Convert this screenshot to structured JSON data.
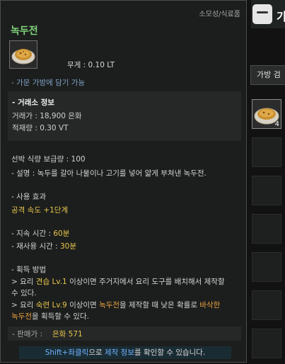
{
  "tooltip": {
    "category": "소모성/식료품",
    "title": "녹두전",
    "weight": "무게 :  0.10 LT",
    "bag_note": "- 가문 가방에 담기 가능",
    "market": {
      "header": "- 거래소 정보",
      "price": "거래가 : 18,900 은화",
      "load": "적재량 : 0.30 VT"
    },
    "ship_food": "선박 식량 보급량 : 100",
    "description": "- 설명 : 녹두를 갈아 나물이나 고기를 넣어 얇게 부쳐낸 녹두전.",
    "effect_header": "- 사용 효과",
    "effect_value": "공격 속도 +1단계",
    "duration_label": "- 지속 시간 : ",
    "duration_value": "60분",
    "cooldown_label": "- 재사용 시간 : ",
    "cooldown_value": "30분",
    "obtain_header": "- 획득 방법",
    "obtain1_a": " > 요리 ",
    "obtain1_b": "견습 Lv.1",
    "obtain1_c": " 이상이면 주거지에서 요리 도구를 배치해서 제작할",
    "obtain1_d": "   수 있다.",
    "obtain2_a": " > 요리 ",
    "obtain2_b": "숙련 Lv.9",
    "obtain2_c": " 이상이면 ",
    "obtain2_d": "녹두전",
    "obtain2_e": "을 제작할 때 낮은 확률로 ",
    "obtain2_f": "바삭한",
    "obtain2_g": "녹두전",
    "obtain2_h": "을 획득할 수 있다.",
    "sell_label": "- 판매가 :",
    "sell_value": "은화 571",
    "hint_a": "Shift+좌클릭",
    "hint_b": "으로 ",
    "hint_c": "제작 정보",
    "hint_d": "를 확인할 수 있습니다."
  },
  "right_panel": {
    "title": "가",
    "bag_button": "가방 검",
    "slot_count": "4"
  }
}
